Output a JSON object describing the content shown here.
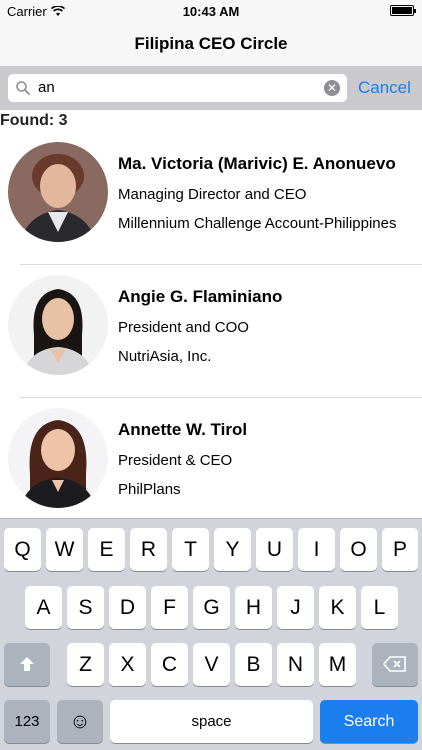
{
  "status": {
    "carrier": "Carrier",
    "time": "10:43 AM"
  },
  "nav": {
    "title": "Filipina CEO Circle"
  },
  "search": {
    "query": "an",
    "cancel_label": "Cancel"
  },
  "results": {
    "found_label": "Found: 3",
    "items": [
      {
        "name": "Ma. Victoria (Marivic) E. Anonuevo",
        "title": "Managing Director and CEO",
        "company": "Millennium Challenge Account-Philippines"
      },
      {
        "name": "Angie G. Flaminiano",
        "title": "President and COO",
        "company": "NutriAsia, Inc."
      },
      {
        "name": "Annette W. Tirol",
        "title": "President & CEO",
        "company": "PhilPlans"
      }
    ]
  },
  "keyboard": {
    "row1": [
      "Q",
      "W",
      "E",
      "R",
      "T",
      "Y",
      "U",
      "I",
      "O",
      "P"
    ],
    "row2": [
      "A",
      "S",
      "D",
      "F",
      "G",
      "H",
      "J",
      "K",
      "L"
    ],
    "row3": [
      "Z",
      "X",
      "C",
      "V",
      "B",
      "N",
      "M"
    ],
    "numbers_label": "123",
    "emoji_label": "☺",
    "space_label": "space",
    "search_label": "Search",
    "shift_icon": "shift-arrow-icon",
    "delete_icon": "backspace-icon"
  },
  "colors": {
    "accent": "#1a7ef0",
    "search_bar_bg": "#c9c9ce",
    "keyboard_bg": "#d1d5db"
  }
}
